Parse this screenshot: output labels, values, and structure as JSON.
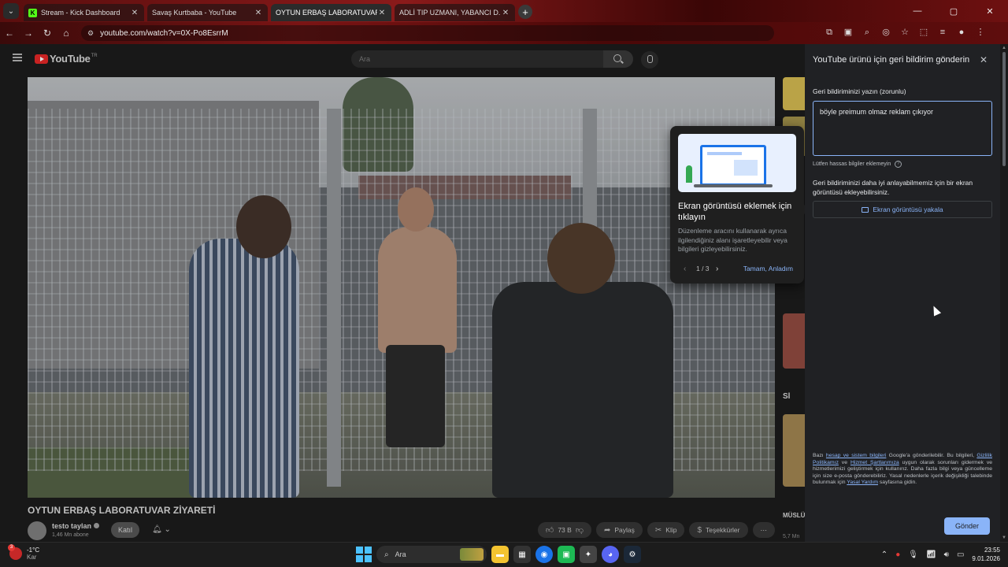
{
  "browser": {
    "tabs": [
      {
        "title": "Stream - Kick Dashboard",
        "favicon": "kick-icon"
      },
      {
        "title": "Savaş Kurtbaba - YouTube",
        "favicon": "youtube-icon"
      },
      {
        "title": "OYTUN ERBAŞ LABORATUVAR",
        "favicon": "youtube-icon",
        "active": true
      },
      {
        "title": "ADLİ TIP UZMANI, YABANCI D...",
        "favicon": "youtube-icon"
      }
    ],
    "url": "youtube.com/watch?v=0X-Po8EsrrM"
  },
  "youtube": {
    "logo_text": "YouTube",
    "logo_region": "TR",
    "search_placeholder": "Ara",
    "video_title": "OYTUN ERBAŞ LABORATUVAR ZİYARETİ",
    "channel_name": "testo taylan",
    "subscribers": "1,46 Mn abone",
    "join_label": "Katıl",
    "likes": "73 B",
    "share_label": "Paylaş",
    "clip_label": "Klip",
    "thanks_label": "Teşekkürler",
    "more_label": "⋯",
    "side_label_1": "Sl",
    "side_title": "MÜSLÜ MISIN?",
    "side_meta": "5,7 Mn"
  },
  "callout": {
    "title": "Ekran görüntüsü eklemek için tıklayın",
    "body": "Düzenleme aracını kullanarak ayrıca ilgilendiğiniz alanı işaretleyebilir veya bilgileri gizleyebilirsiniz.",
    "page_indicator": "1 / 3",
    "ok_label": "Tamam, Anladım"
  },
  "feedback": {
    "title": "YouTube ürünü için geri bildirim gönderin",
    "field_label": "Geri bildiriminizi yazın (zorunlu)",
    "field_value": "böyle preimum olmaz reklam çıkıyor",
    "hint": "Lütfen hassas bilgiler eklemeyin",
    "screenshot_desc": "Geri bildiriminizi daha iyi anlayabilmemiz için bir ekran görüntüsü ekleyebilirsiniz.",
    "screenshot_button": "Ekran görüntüsü yakala",
    "legal_1": "Bazı ",
    "legal_link_1": "hesap ve sistem bilgileri",
    "legal_2": " Google'a gönderilebilir. Bu bilgileri, ",
    "legal_link_2": "Gizlilik Politikamız",
    "legal_3": " ve ",
    "legal_link_3": "Hizmet Şartlarımıza",
    "legal_4": " uygun olarak sorunları gidermek ve hizmetlerimizi geliştirmek için kullanırız. Daha fazla bilgi veya güncelleme için size e-posta gönderebiliriz. Yasal nedenlerle içerik değişikliği talebinde bulunmak için ",
    "legal_link_4": "Yasal Yardım",
    "legal_5": " sayfasına gidin.",
    "send_label": "Gönder"
  },
  "taskbar": {
    "weather_temp": "-1°C",
    "weather_desc": "Kar",
    "weather_badge": "3",
    "search_label": "Ara",
    "time": "23:55",
    "date": "9.01.2026"
  },
  "colors": {
    "accent_blue": "#8ab4f8",
    "panel_bg": "#202124",
    "youtube_red": "#ff0000"
  }
}
